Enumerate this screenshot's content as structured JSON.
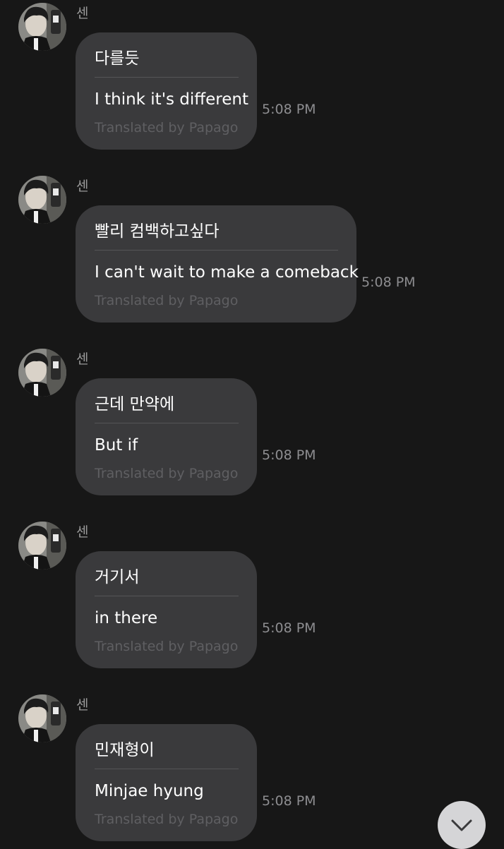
{
  "chat": {
    "messages": [
      {
        "sender": "센",
        "original": "다를듯",
        "translation": "I think it's different",
        "credit": "Translated by Papago",
        "time": "5:08 PM"
      },
      {
        "sender": "센",
        "original": "빨리 컴백하고싶다",
        "translation": "I can't wait to make a comeback",
        "credit": "Translated by Papago",
        "time": "5:08 PM"
      },
      {
        "sender": "센",
        "original": "근데 만약에",
        "translation": "But if",
        "credit": "Translated by Papago",
        "time": "5:08 PM"
      },
      {
        "sender": "센",
        "original": "거기서",
        "translation": "in there",
        "credit": "Translated by Papago",
        "time": "5:08 PM"
      },
      {
        "sender": "센",
        "original": "민재형이",
        "translation": "Minjae hyung",
        "credit": "Translated by Papago",
        "time": "5:08 PM"
      }
    ]
  },
  "scroll_button": {
    "icon": "chevron-down-icon"
  },
  "colors": {
    "background": "#171717",
    "bubble": "#3a3a3c",
    "sender_text": "#9a9a9a",
    "credit_text": "#5f5f62",
    "time_text": "#8d8d90",
    "scroll_button": "#d5d5d7"
  }
}
